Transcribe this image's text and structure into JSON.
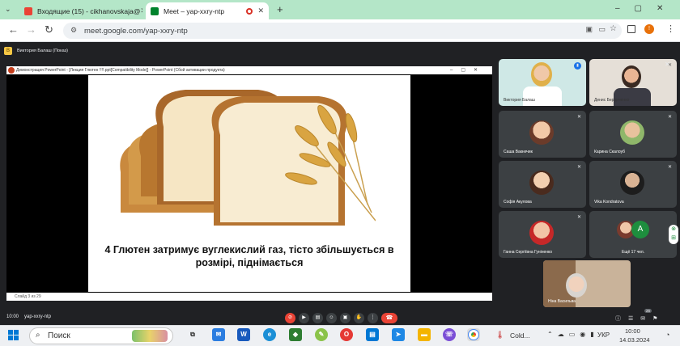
{
  "browser": {
    "tabs": [
      {
        "title": "Входящие (15) - cikhanovskaja@"
      },
      {
        "title": "Meet – yap-xxry-ntp"
      }
    ],
    "new_tab": "+",
    "url": "meet.google.com/yap-xxry-ntp",
    "profile_initial": "!"
  },
  "meet": {
    "presenter_label": "Виктория Балаш (Показ)",
    "presenter_initial": "В",
    "slide_window_title": "Демонстрация PowerPoint - [Лекция Глютен !!!!.ppt[Compatibility Mode]] - PowerPoint (Сбой активации продукта)",
    "slide_caption": "4 Глютен затримує вуглекислий газ, тісто збільшується в розмірі, піднімається",
    "slide_counter": "Слайд 3 из 29",
    "participants": [
      {
        "name": "Виктория Балаш"
      },
      {
        "name": "Денис Бердиченко"
      },
      {
        "name": "Саша Вакнечик"
      },
      {
        "name": "Карина Скалоуб"
      },
      {
        "name": "Софія Акулова"
      },
      {
        "name": "Vika Kondratova"
      },
      {
        "name": "Ганна Сергіївна Гуніненко"
      },
      {
        "name": "Ещё 17 чел."
      }
    ],
    "more_avatar_letter": "A",
    "self_name": "Ніна Васильва",
    "time": "10:00",
    "meeting_code": "yap-xxry-ntp",
    "participant_count": "26"
  },
  "taskbar": {
    "search_placeholder": "Поиск",
    "weather": "Cold...",
    "lang": "УКР",
    "time": "10:00",
    "date": "14.03.2024"
  },
  "colors": {
    "tabbar": "#b4e6c8",
    "end_call": "#ea4335",
    "meet_bg": "#202124"
  }
}
